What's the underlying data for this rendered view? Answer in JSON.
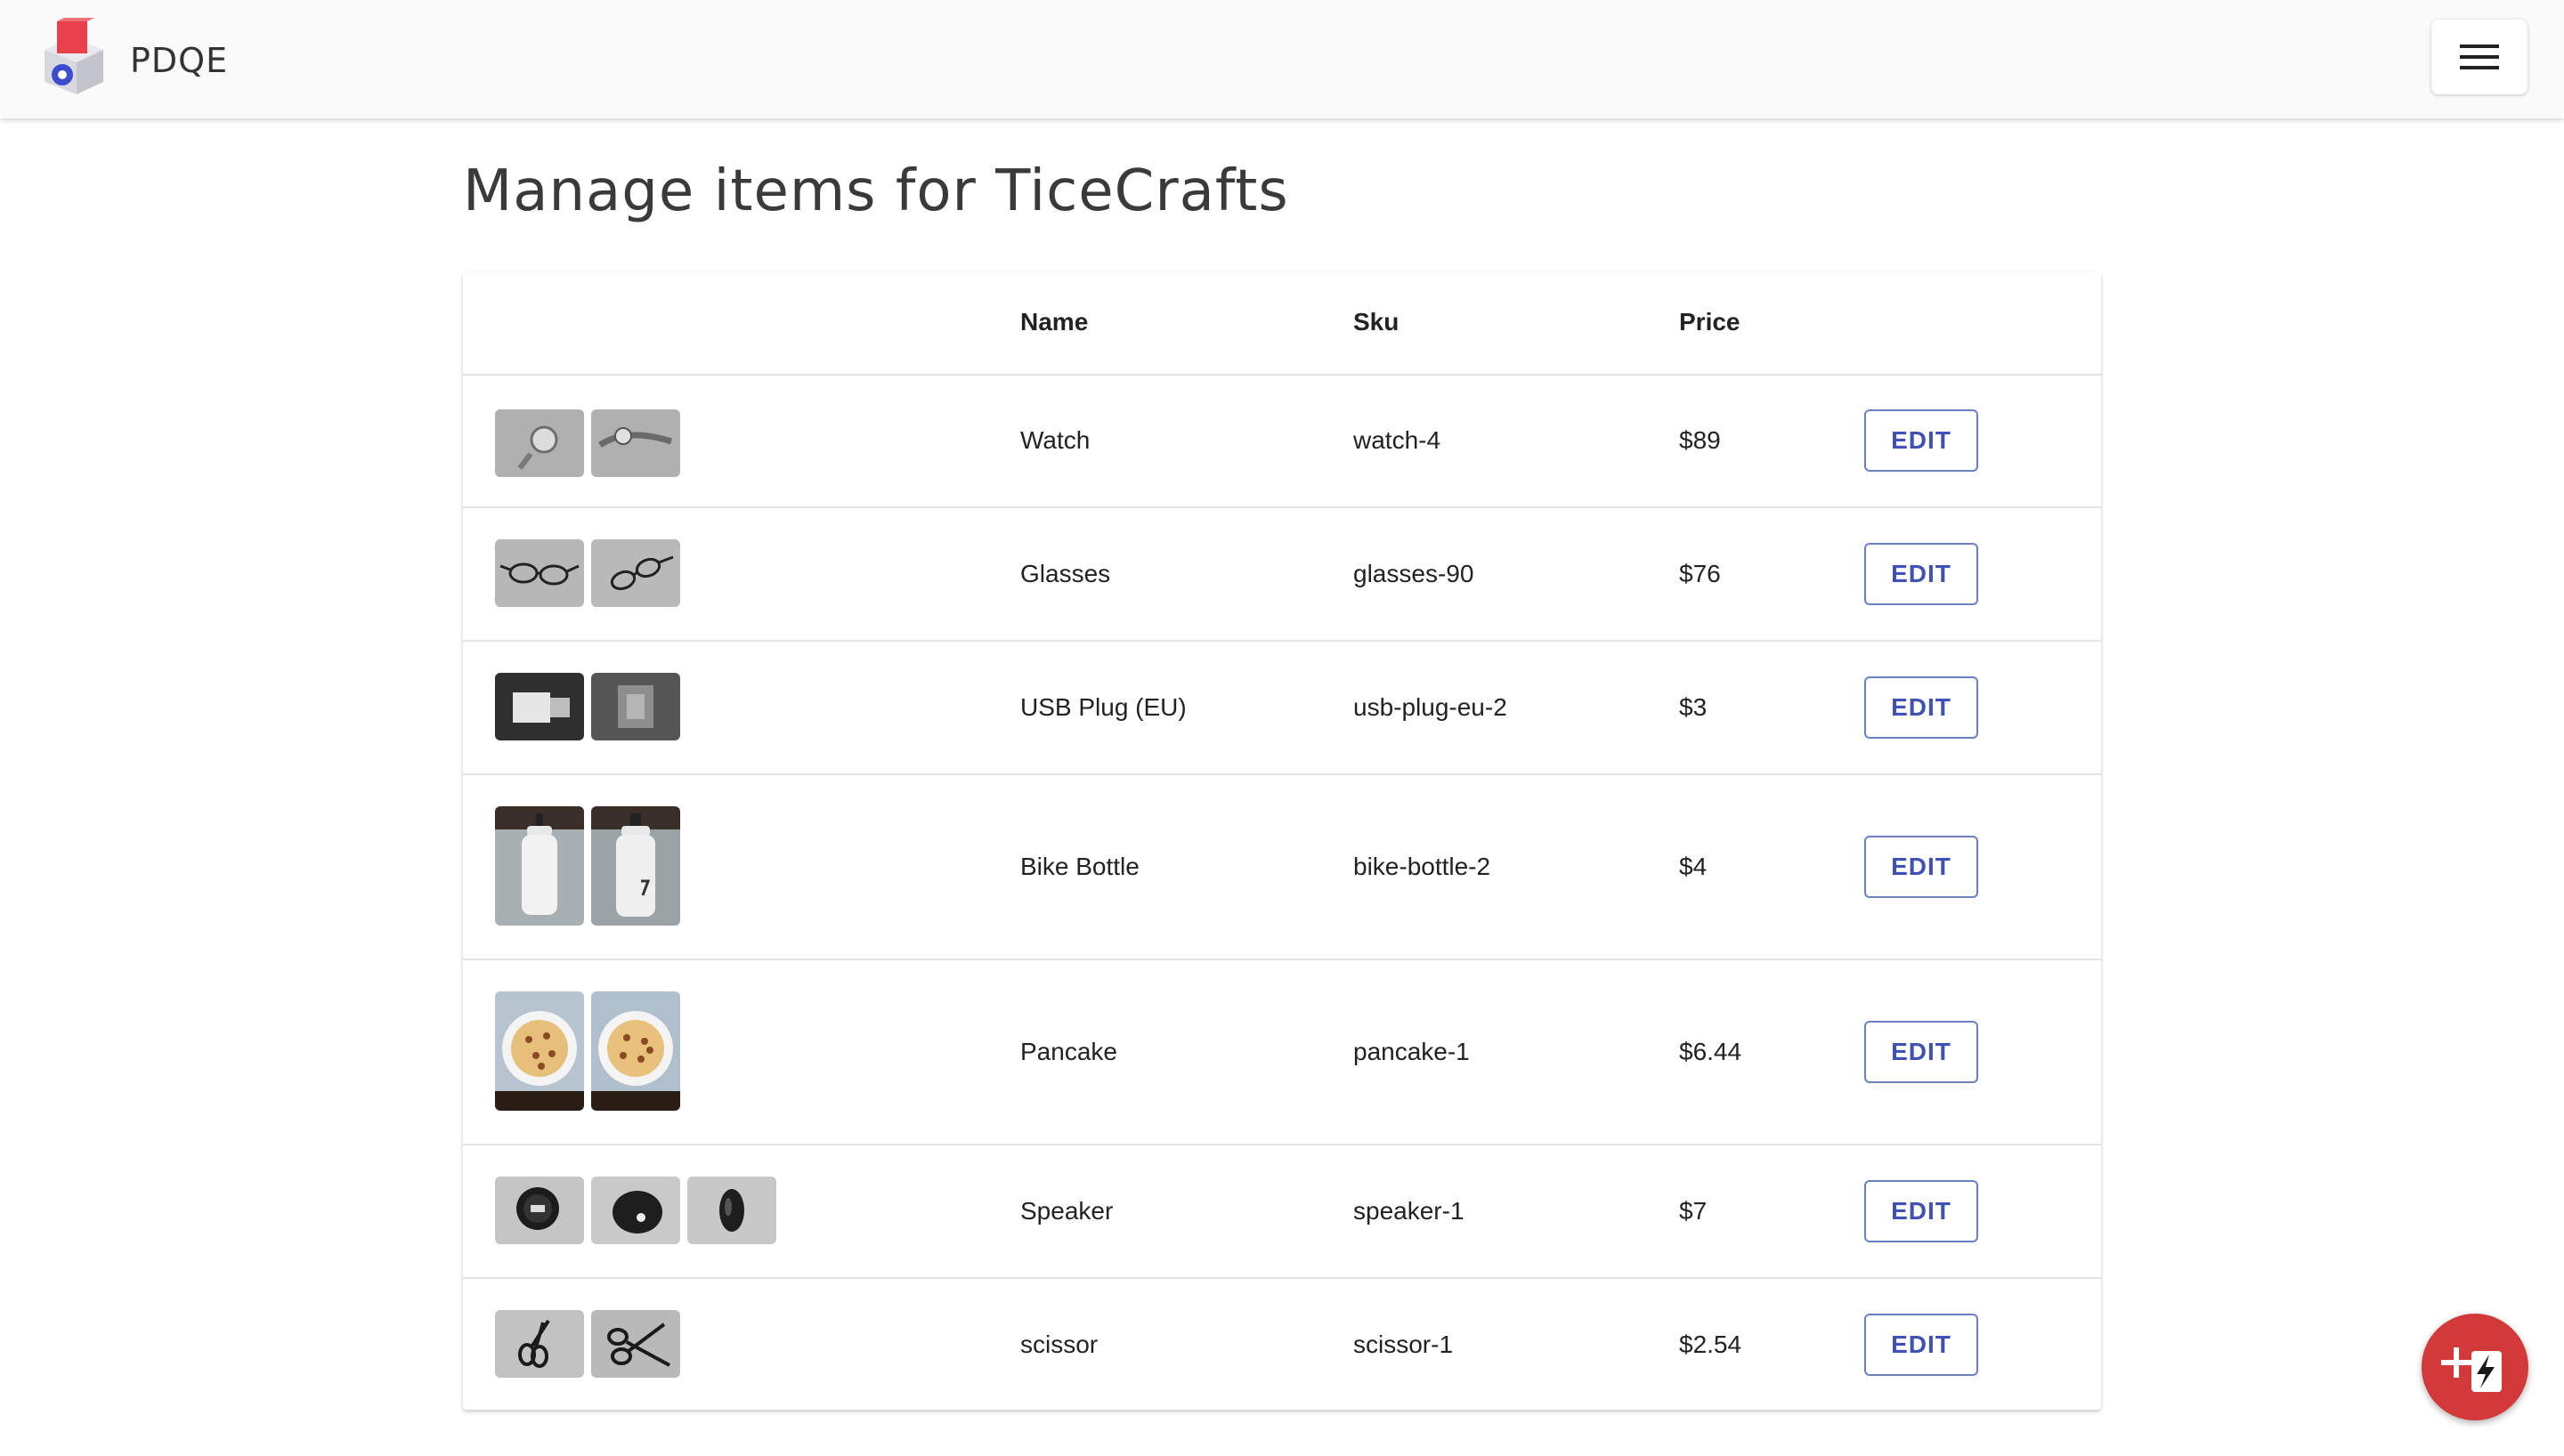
{
  "header": {
    "brand": "PDQE",
    "logo_icon": "cube-logo-icon",
    "menu_icon": "hamburger-menu-icon"
  },
  "page": {
    "title": "Manage items for TiceCrafts"
  },
  "table": {
    "columns": {
      "image": "",
      "name": "Name",
      "sku": "Sku",
      "price": "Price"
    },
    "rows": [
      {
        "name": "Watch",
        "sku": "watch-4",
        "price": "$89",
        "action": "EDIT",
        "thumbnails": [
          "watch",
          "watch"
        ]
      },
      {
        "name": "Glasses",
        "sku": "glasses-90",
        "price": "$76",
        "action": "EDIT",
        "thumbnails": [
          "glasses",
          "glasses"
        ]
      },
      {
        "name": "USB Plug (EU)",
        "sku": "usb-plug-eu-2",
        "price": "$3",
        "action": "EDIT",
        "thumbnails": [
          "usb-plug",
          "usb-plug"
        ]
      },
      {
        "name": "Bike Bottle",
        "sku": "bike-bottle-2",
        "price": "$4",
        "action": "EDIT",
        "thumbnails": [
          "bottle",
          "bottle"
        ]
      },
      {
        "name": "Pancake",
        "sku": "pancake-1",
        "price": "$6.44",
        "action": "EDIT",
        "thumbnails": [
          "pancake",
          "pancake"
        ]
      },
      {
        "name": "Speaker",
        "sku": "speaker-1",
        "price": "$7",
        "action": "EDIT",
        "thumbnails": [
          "speaker",
          "speaker",
          "speaker"
        ]
      },
      {
        "name": "scissor",
        "sku": "scissor-1",
        "price": "$2.54",
        "action": "EDIT",
        "thumbnails": [
          "scissors",
          "scissors"
        ]
      }
    ]
  },
  "fab": {
    "icon": "add-quick-item-icon"
  },
  "colors": {
    "accent": "#3f51b5",
    "fab": "#d23a3a",
    "appbar": "#fafafa"
  }
}
